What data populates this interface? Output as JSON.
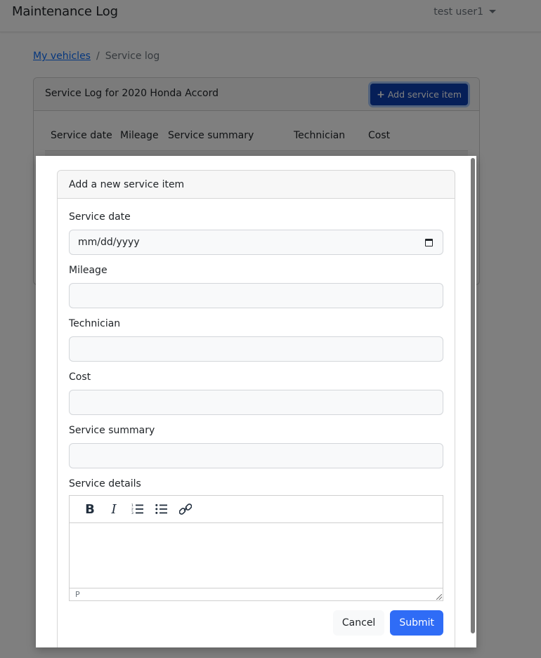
{
  "navbar": {
    "brand": "Maintenance Log",
    "user": "test user1"
  },
  "breadcrumb": {
    "link": "My vehicles",
    "separator": "/",
    "current": "Service log"
  },
  "service_log_card": {
    "title": "Service Log for 2020 Honda Accord",
    "add_button": "Add service item",
    "add_button_icon": "plus-icon",
    "columns": [
      "Service date",
      "Mileage",
      "Service summary",
      "Technician",
      "Cost"
    ]
  },
  "modal": {
    "title": "Add a new service item",
    "fields": {
      "service_date": {
        "label": "Service date",
        "placeholder": "mm/dd/yyyy",
        "value": ""
      },
      "mileage": {
        "label": "Mileage",
        "value": ""
      },
      "technician": {
        "label": "Technician",
        "value": ""
      },
      "cost": {
        "label": "Cost",
        "value": ""
      },
      "service_summary": {
        "label": "Service summary",
        "value": ""
      },
      "service_details": {
        "label": "Service details",
        "value": ""
      }
    },
    "editor": {
      "toolbar": [
        "bold",
        "italic",
        "ordered-list",
        "unordered-list",
        "link"
      ],
      "bold_glyph": "B",
      "italic_glyph": "I",
      "status_path": "P"
    },
    "cancel_label": "Cancel",
    "submit_label": "Submit"
  },
  "colors": {
    "primary": "#2f6cf6",
    "add_button": "#0d3fb0",
    "link": "#0d6efd",
    "backdrop": "rgba(0,0,0,0.5)"
  }
}
